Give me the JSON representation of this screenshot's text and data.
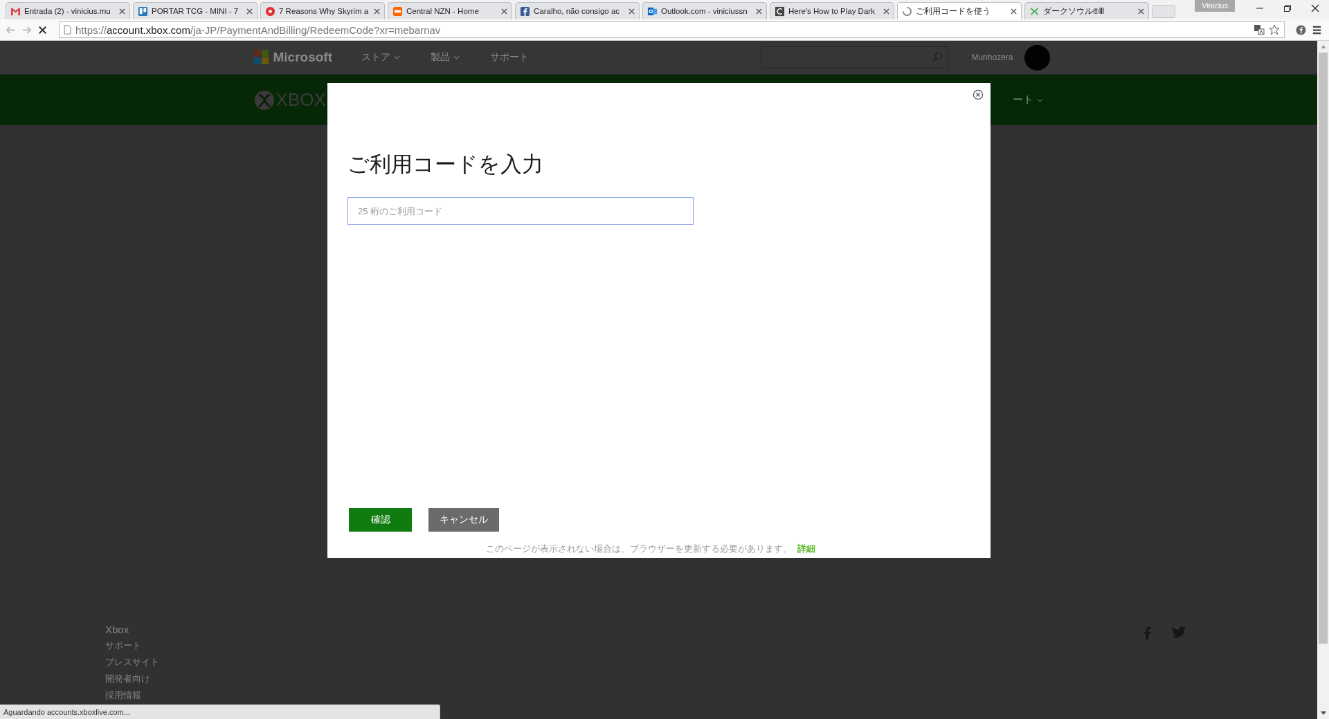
{
  "browser": {
    "tabs": [
      {
        "title": "Entrada (2) - vinicius.mu",
        "selected": false
      },
      {
        "title": "PORTAR TCG - MINI - 7",
        "selected": false
      },
      {
        "title": "7 Reasons Why Skyrim a",
        "selected": false
      },
      {
        "title": "Central NZN - Home",
        "selected": false
      },
      {
        "title": "Caralho, não consigo ac",
        "selected": false
      },
      {
        "title": "Outlook.com - viniciussn",
        "selected": false
      },
      {
        "title": "Here's How to Play Dark",
        "selected": false
      },
      {
        "title": "ご利用コードを使う",
        "selected": true
      },
      {
        "title": "ダークソウル®Ⅲ",
        "selected": false
      }
    ],
    "profile_name": "Vinicius",
    "url": {
      "scheme": "https://",
      "host": "account.xbox.com",
      "path": "/ja-JP/PaymentAndBilling/RedeemCode?xr=mebarnav"
    }
  },
  "site_header": {
    "logo_text": "Microsoft",
    "nav": [
      {
        "label": "ストア",
        "dropdown": true
      },
      {
        "label": "製品",
        "dropdown": true
      },
      {
        "label": "サポート",
        "dropdown": false
      }
    ],
    "user_name": "Munhozera"
  },
  "xbox_bar": {
    "logo_text": "XBOX",
    "nav_fragment": "ート"
  },
  "dialog": {
    "title": "ご利用コードを入力",
    "code_field": {
      "placeholder": "25 桁のご利用コード"
    },
    "buttons": [
      {
        "label": "確認",
        "kind": "primary"
      },
      {
        "label": "キャンセル",
        "kind": "secondary"
      }
    ],
    "notice": {
      "text": "このページが表示されない場合は、ブラウザーを更新する必要があります。",
      "link": "詳細"
    }
  },
  "footer": {
    "heading": "Xbox",
    "links": [
      "サポート",
      "プレスサイト",
      "開発者向け",
      "採用情報"
    ]
  },
  "status_bar": "Aguardando accounts.xboxlive.com..."
}
